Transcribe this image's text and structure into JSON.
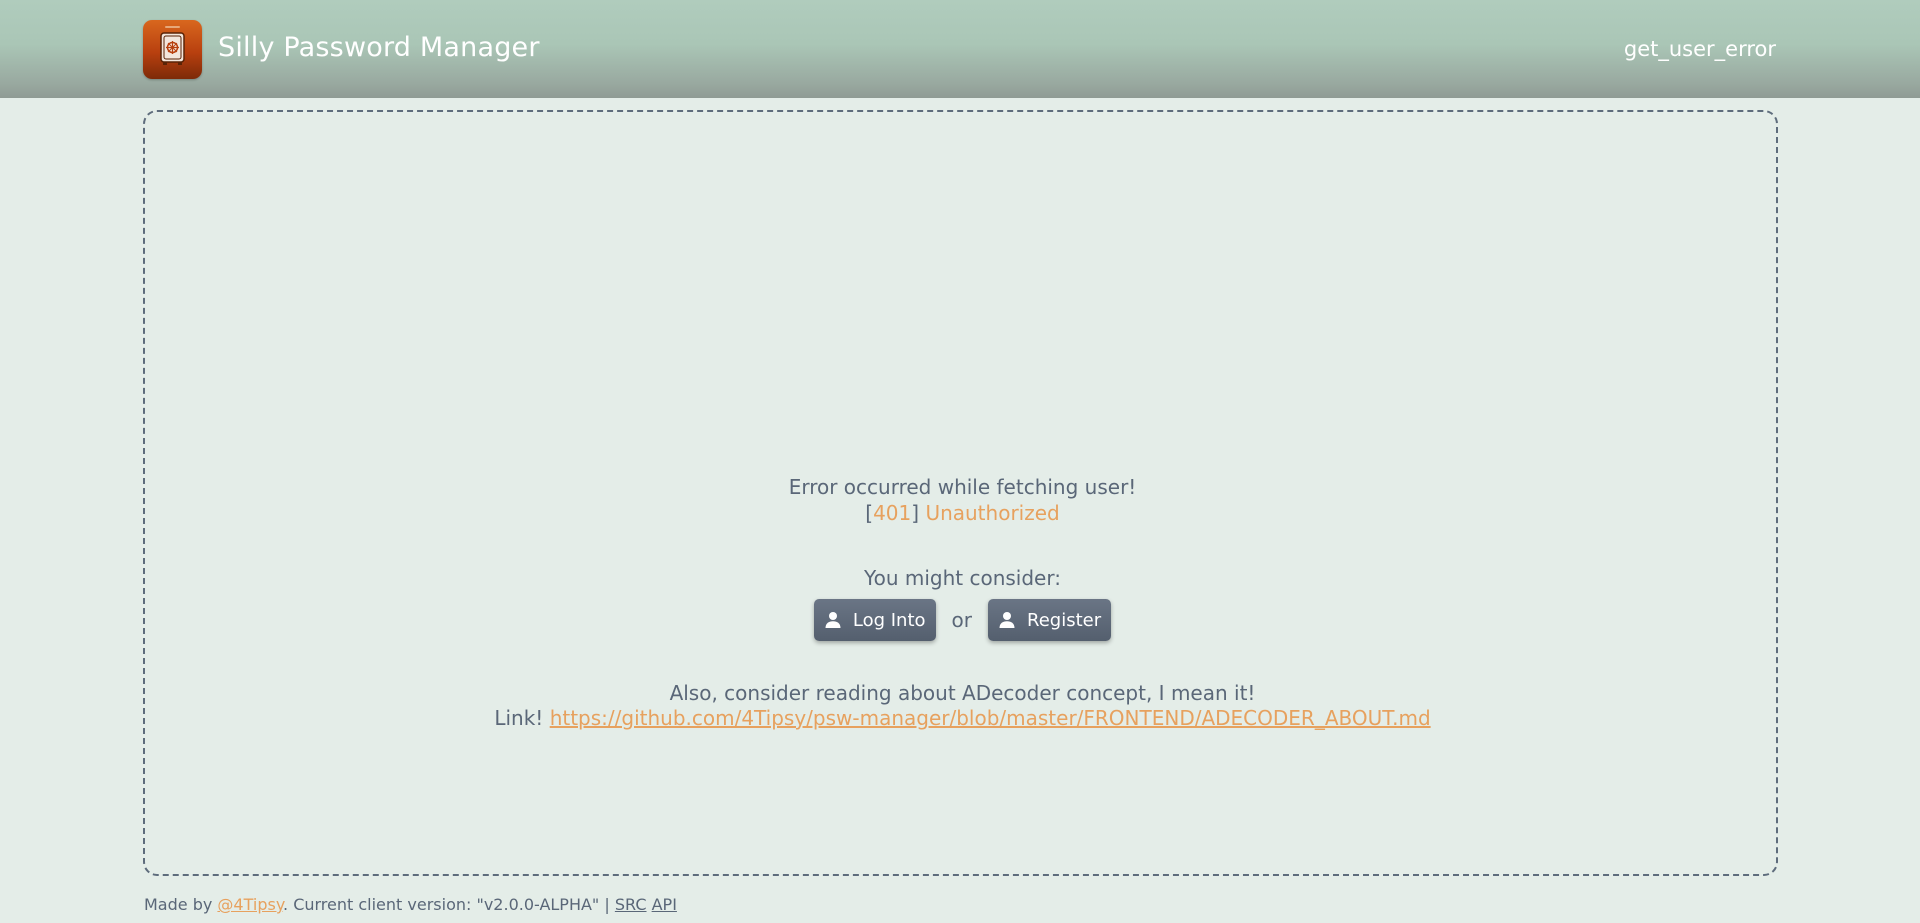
{
  "header": {
    "app_title": "Silly Password Manager",
    "status_text": "get_user_error",
    "logo_icon": "safe-icon"
  },
  "error": {
    "title": "Error occurred while fetching user!",
    "bracket_open": "[",
    "code": "401",
    "bracket_close": "]",
    "message": "Unauthorized"
  },
  "actions": {
    "consider_text": "You might consider:",
    "login_label": "Log Into",
    "or_text": "or",
    "register_label": "Register",
    "button_icon": "user-icon"
  },
  "info": {
    "also_text": "Also, consider reading about ADecoder concept, I mean it!",
    "link_prefix": "Link!",
    "link_url": "https://github.com/4Tipsy/psw-manager/blob/master/FRONTEND/ADECODER_ABOUT.md"
  },
  "footer": {
    "made_by": "Made by",
    "author": "@4Tipsy",
    "version_text": ". Current client version: \"v2.0.0-ALPHA\" |",
    "src_label": "SRC",
    "api_label": "API"
  },
  "colors": {
    "accent": "#e7a15e",
    "text": "#5a6778",
    "background": "#e4ede8",
    "header_top": "#b0ccbd",
    "button": "#5e6978"
  }
}
